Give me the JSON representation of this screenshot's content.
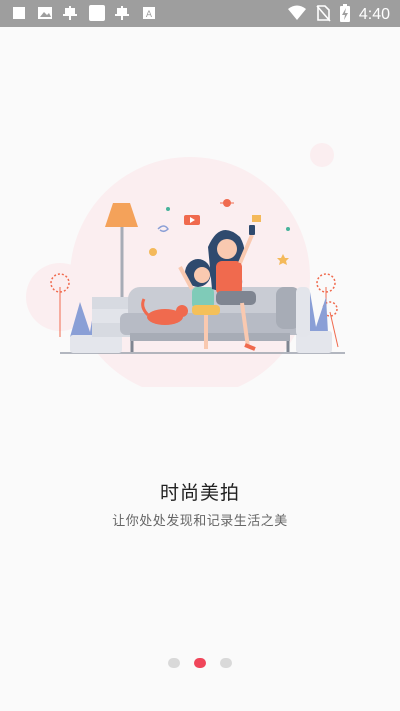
{
  "status_bar": {
    "time": "4:40",
    "left_icons": [
      "square-icon",
      "image-icon",
      "bug-icon",
      "square-icon",
      "bug-icon",
      "font-icon"
    ],
    "right_icons": [
      "wifi-icon",
      "no-sim-icon",
      "battery-charging-icon"
    ]
  },
  "onboarding": {
    "title": "时尚美拍",
    "subtitle": "让你处处发现和记录生活之美",
    "page_index": 1,
    "page_count": 3
  },
  "colors": {
    "status_bar": "#9e9e9e",
    "background": "#fafafa",
    "accent": "#f0465a",
    "dot_inactive": "#d9d9d9"
  }
}
